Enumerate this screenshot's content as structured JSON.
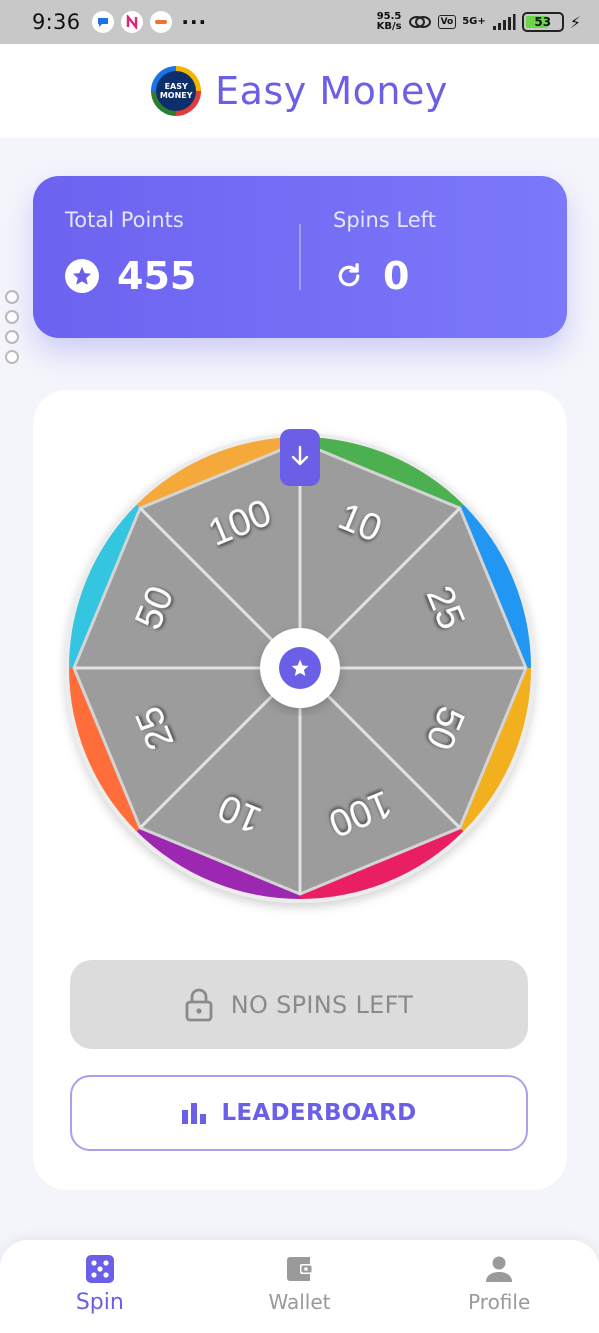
{
  "status_bar": {
    "time": "9:36",
    "speed_value": "95.5",
    "speed_unit": "KB/s",
    "volte": "VoLTE",
    "network": "5G+",
    "battery": "53"
  },
  "app": {
    "title": "Easy Money",
    "logo_text_line1": "EASY",
    "logo_text_line2": "MONEY"
  },
  "stats": {
    "total_points_label": "Total Points",
    "total_points_value": "455",
    "spins_left_label": "Spins Left",
    "spins_left_value": "0"
  },
  "wheel": {
    "segments": [
      "10",
      "25",
      "50",
      "100",
      "10",
      "25",
      "50",
      "100"
    ],
    "rim_colors": [
      "#4caf50",
      "#2196f3",
      "#f2b01e",
      "#e91e63",
      "#9c27b0",
      "#ff6d3a",
      "#34c6e0",
      "#f5a93a"
    ],
    "face_color": "#9c9c9c",
    "accent": "#6b5fe8"
  },
  "buttons": {
    "no_spins": "NO SPINS LEFT",
    "leaderboard": "LEADERBOARD"
  },
  "nav": {
    "items": [
      {
        "label": "Spin",
        "icon": "dice-icon",
        "active": true
      },
      {
        "label": "Wallet",
        "icon": "wallet-icon",
        "active": false
      },
      {
        "label": "Profile",
        "icon": "person-icon",
        "active": false
      }
    ]
  },
  "colors": {
    "primary": "#6b5fe8",
    "muted": "#9a9a9a",
    "disabled_bg": "#dcdcdc"
  }
}
